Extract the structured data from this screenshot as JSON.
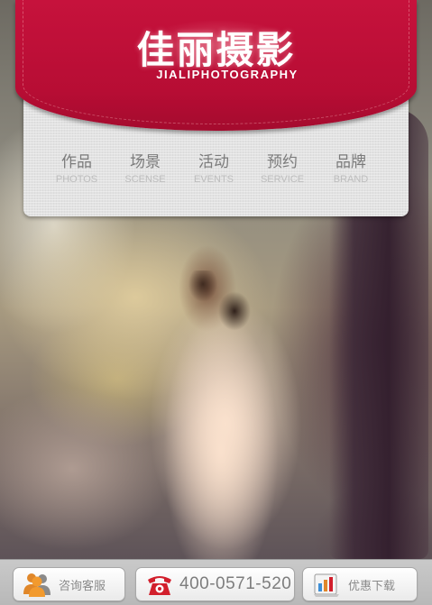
{
  "header": {
    "brand_cn": "佳丽摄影",
    "brand_en": "JIALIPHOTOGRAPHY",
    "accent_color": "#c6123c"
  },
  "nav": {
    "items": [
      {
        "cn": "作品",
        "en": "PHOTOS"
      },
      {
        "cn": "场景",
        "en": "SCENSE"
      },
      {
        "cn": "活动",
        "en": "EVENTS"
      },
      {
        "cn": "预约",
        "en": "SERVICE"
      },
      {
        "cn": "品牌",
        "en": "BRAND"
      }
    ]
  },
  "hero": {
    "image": "wedding-couple-forest-photo"
  },
  "toolbar": {
    "consult_label": "咨询客服",
    "consult_icon": "people-icon",
    "phone_number": "400-0571-520",
    "phone_icon": "telephone-icon",
    "download_label": "优惠下载",
    "download_icon": "chart-download-icon"
  }
}
